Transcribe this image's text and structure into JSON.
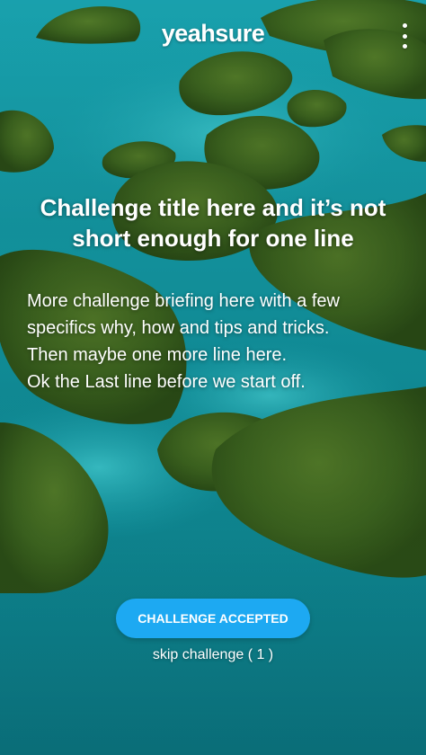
{
  "app": {
    "logo_text": "yeahsure"
  },
  "header": {
    "menu_icon": "more-vertical-icon"
  },
  "challenge": {
    "title": "Challenge title here and it’s not short enough for one line",
    "briefing_lines": [
      "More challenge briefing here with a few",
      "specifics why, how and tips and tricks.",
      "Then maybe one more line here.",
      "Ok the Last line before we start off."
    ]
  },
  "actions": {
    "accept_label": "CHALLENGE ACCEPTED",
    "skip_label": "skip challenge ( 1 )"
  },
  "colors": {
    "accent": "#1da9f2",
    "water": "#1aa9b6",
    "island": "#3f6b22"
  },
  "background": {
    "description_icon": "island-landscape-image"
  }
}
